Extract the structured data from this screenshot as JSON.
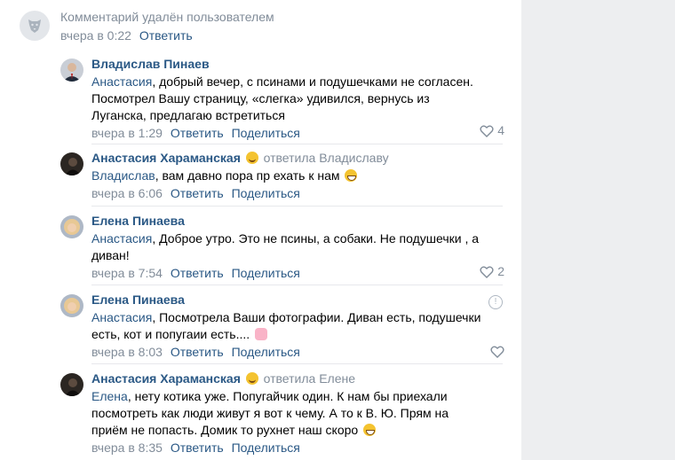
{
  "deleted_comment": {
    "text": "Комментарий удалён пользователем",
    "time": "вчера в 0:22",
    "reply": "Ответить"
  },
  "comments": [
    {
      "author": "Владислав Пинаев",
      "reply_to": "",
      "mention": "Анастасия",
      "lines": [
        ", добрый вечер, с псинами и подушечками не согласен.",
        "Посмотрел Вашу страницу, «слегка» удивился, вернусь из",
        "Луганска, предлагаю встретиться"
      ],
      "time": "вчера в 1:29",
      "reply": "Ответить",
      "share": "Поделиться",
      "likes": "4"
    },
    {
      "author": "Анастасия Хараманская",
      "reply_to": "ответила Владиславу",
      "mention": "Владислав",
      "lines": [
        ", вам давно пора пр ехать к нам"
      ],
      "time": "вчера в 6:06",
      "reply": "Ответить",
      "share": "Поделиться",
      "likes": ""
    },
    {
      "author": "Елена Пинаева",
      "reply_to": "",
      "mention": "Анастасия",
      "lines": [
        ", Доброе утро. Это не псины, а собаки. Не подушечки , а",
        "диван!"
      ],
      "time": "вчера в 7:54",
      "reply": "Ответить",
      "share": "Поделиться",
      "likes": "2"
    },
    {
      "author": "Елена Пинаева",
      "reply_to": "",
      "mention": "Анастасия",
      "lines": [
        ", Посмотрела Ваши фотографии. Диван есть, подушечки",
        "есть, кот и попугаии есть...."
      ],
      "time": "вчера в 8:03",
      "reply": "Ответить",
      "share": "Поделиться",
      "likes": ""
    },
    {
      "author": "Анастасия Хараманская",
      "reply_to": "ответила Елене",
      "mention": "Елена",
      "lines": [
        ", нету котика уже. Попугайчик один. К нам бы приехали",
        "посмотреть как люди живут я вот к чему. А то к В. Ю. Прям на",
        "приём не попасть. Домик то рухнет наш скоро"
      ],
      "time": "вчера в 8:35",
      "reply": "Ответить",
      "share": "Поделиться",
      "likes": ""
    }
  ],
  "colors": {
    "link": "#2a5885",
    "muted": "#818c99",
    "panel": "#edeef0"
  },
  "icons": [
    "deleted-user-dog-icon",
    "heart-icon",
    "report-icon",
    "smile-emoji",
    "grin-emoji",
    "person-emoji"
  ]
}
